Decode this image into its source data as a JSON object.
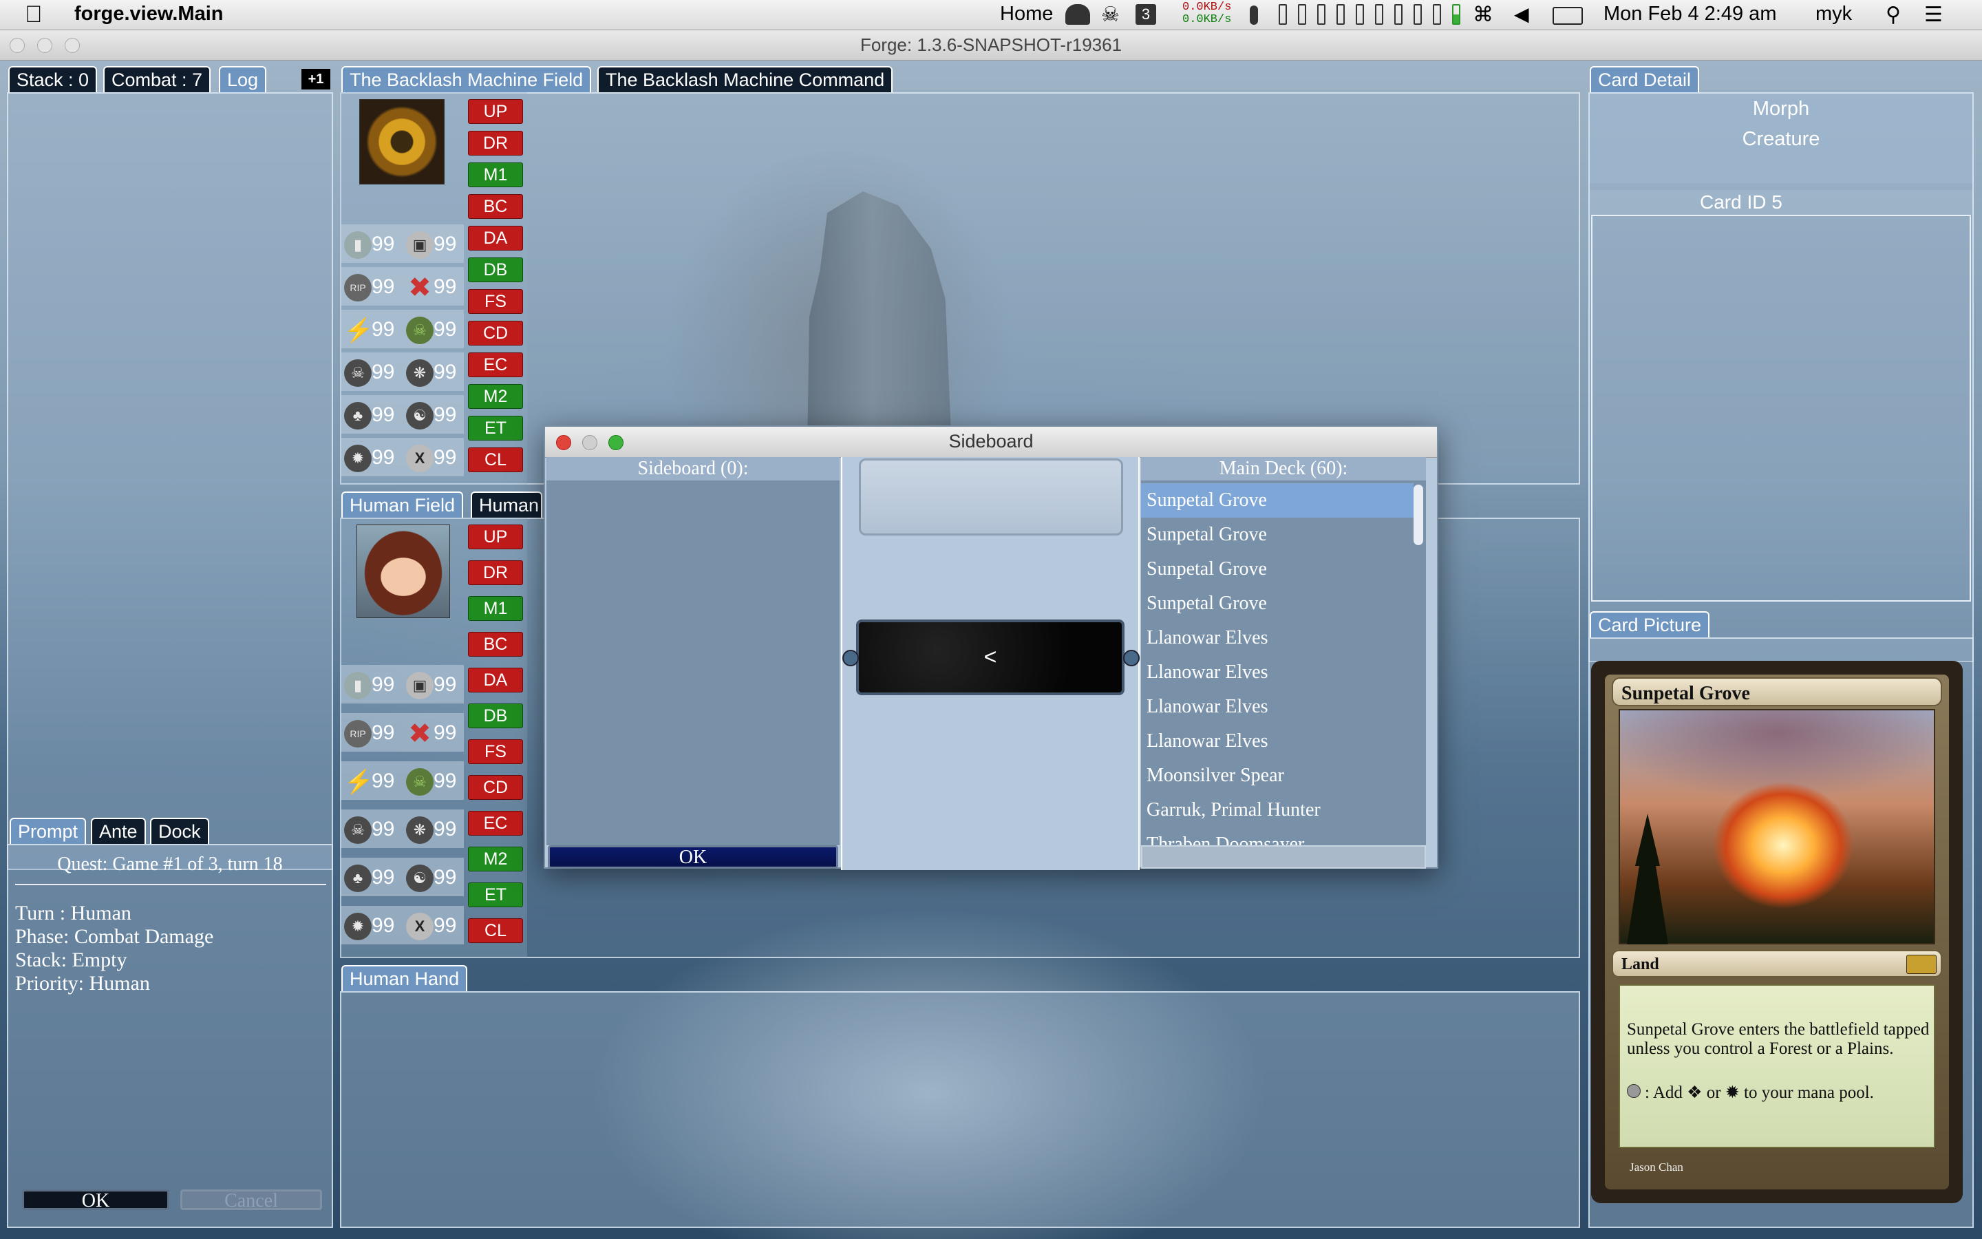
{
  "menubar": {
    "app_name": "forge.view.Main",
    "home": "Home",
    "badge": "3",
    "net_up": "0.0KB/s",
    "net_down": "0.0KB/s",
    "clock": "Mon Feb 4  2:49 am",
    "user": "myk"
  },
  "window": {
    "title": "Forge: 1.3.6-SNAPSHOT-r19361"
  },
  "left_tabs": {
    "stack": "Stack : 0",
    "combat": "Combat : 7",
    "log": "Log",
    "plus": "+1"
  },
  "ai_field": {
    "tab_field": "The Backlash Machine Field",
    "tab_command": "The Backlash Machine Command",
    "zones": [
      "99",
      "99",
      "99",
      "99",
      "99",
      "99",
      "99",
      "99",
      "99",
      "99",
      "99",
      "99"
    ]
  },
  "human_field": {
    "tab_field": "Human Field",
    "tab_command": "Human",
    "zones": [
      "99",
      "99",
      "99",
      "99",
      "99",
      "99",
      "99",
      "99",
      "99",
      "99",
      "99",
      "99"
    ]
  },
  "phases": [
    {
      "label": "UP",
      "color": "#c01b1b"
    },
    {
      "label": "DR",
      "color": "#c01b1b"
    },
    {
      "label": "M1",
      "color": "#1f8c1f"
    },
    {
      "label": "BC",
      "color": "#c01b1b"
    },
    {
      "label": "DA",
      "color": "#c01b1b"
    },
    {
      "label": "DB",
      "color": "#1f8c1f"
    },
    {
      "label": "FS",
      "color": "#c01b1b"
    },
    {
      "label": "CD",
      "color": "#c01b1b"
    },
    {
      "label": "EC",
      "color": "#c01b1b"
    },
    {
      "label": "M2",
      "color": "#1f8c1f"
    },
    {
      "label": "ET",
      "color": "#1f8c1f"
    },
    {
      "label": "CL",
      "color": "#c01b1b"
    }
  ],
  "prompt_tabs": {
    "prompt": "Prompt",
    "ante": "Ante",
    "dock": "Dock"
  },
  "prompt": {
    "quest": "Quest: Game #1 of 3, turn 18",
    "turn": "Turn : Human",
    "phase": "Phase: Combat Damage",
    "stack": "Stack: Empty",
    "priority": "Priority: Human",
    "ok": "OK",
    "cancel": "Cancel"
  },
  "hand_tab": "Human Hand",
  "card_detail": {
    "tab": "Card Detail",
    "name": "Morph",
    "type": "Creature",
    "id": "Card ID  5"
  },
  "card_picture": {
    "tab": "Card Picture",
    "name": "Sunpetal Grove",
    "type": "Land",
    "rules1": "Sunpetal Grove enters the battlefield tapped unless you control a Forest or a Plains.",
    "rules2": ": Add ❖ or ✹ to your mana pool.",
    "artist": "Jason Chan"
  },
  "dialog": {
    "title": "Sideboard",
    "sideboard_header": "Sideboard (0):",
    "main_header": "Main Deck (60):",
    "move_button": "<",
    "ok": "OK",
    "main_deck": [
      "Sunpetal Grove",
      "Sunpetal Grove",
      "Sunpetal Grove",
      "Sunpetal Grove",
      "Llanowar Elves",
      "Llanowar Elves",
      "Llanowar Elves",
      "Llanowar Elves",
      "Moonsilver Spear",
      "Garruk, Primal Hunter",
      "Thraben Doomsayer"
    ]
  },
  "colors": {
    "phase_red": "#c01b1b",
    "phase_green": "#1f8c1f",
    "tab_dark": "#0f1c2b",
    "tab_light": "#6e95bf"
  }
}
